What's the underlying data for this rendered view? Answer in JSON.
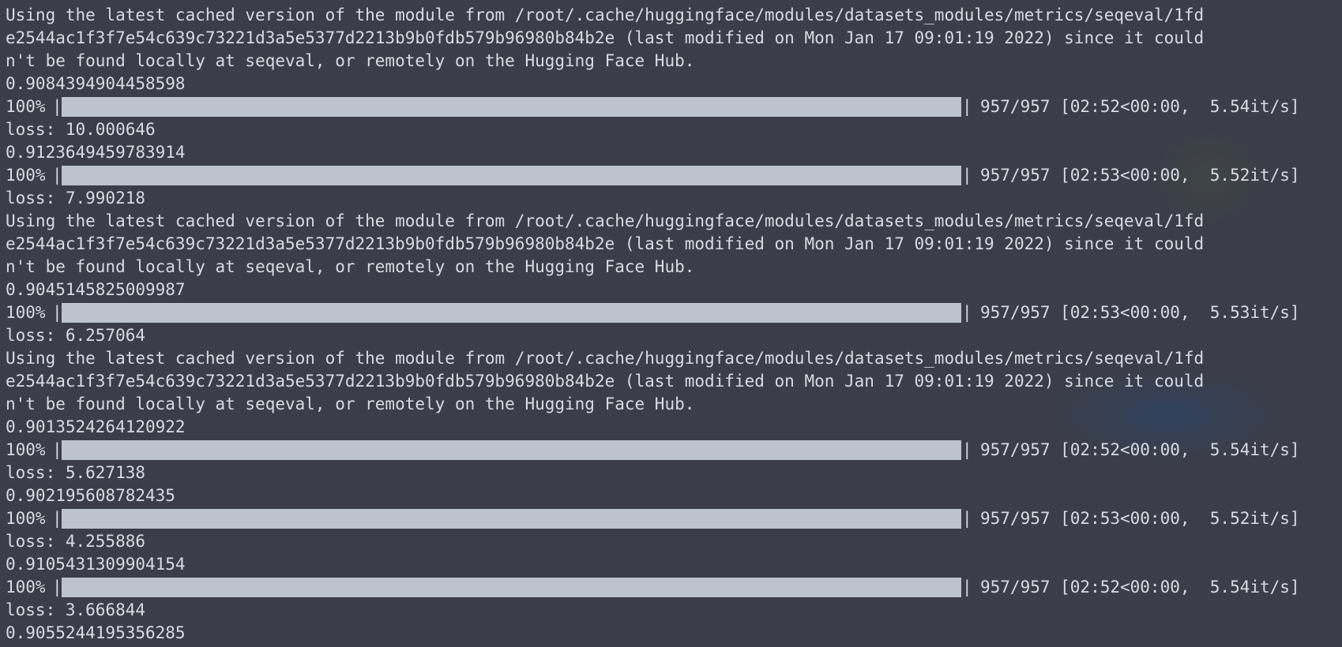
{
  "terminal": {
    "lines": [
      {
        "kind": "text",
        "text": "Using the latest cached version of the module from /root/.cache/huggingface/modules/datasets_modules/metrics/seqeval/1fd"
      },
      {
        "kind": "text",
        "text": "e2544ac1f3f7e54c639c73221d3a5e5377d2213b9b0fdb579b96980b84b2e (last modified on Mon Jan 17 09:01:19 2022) since it could"
      },
      {
        "kind": "text",
        "text": "n't be found locally at seqeval, or remotely on the Hugging Face Hub."
      },
      {
        "kind": "text",
        "text": "0.9084394904458598"
      },
      {
        "kind": "progress",
        "percent": "100%",
        "fraction": 1.0,
        "stats": "957/957 [02:52<00:00,  5.54it/s]"
      },
      {
        "kind": "text",
        "text": "loss: 10.000646"
      },
      {
        "kind": "text",
        "text": "0.9123649459783914"
      },
      {
        "kind": "progress",
        "percent": "100%",
        "fraction": 1.0,
        "stats": "957/957 [02:53<00:00,  5.52it/s]"
      },
      {
        "kind": "text",
        "text": "loss: 7.990218"
      },
      {
        "kind": "text",
        "text": "Using the latest cached version of the module from /root/.cache/huggingface/modules/datasets_modules/metrics/seqeval/1fd"
      },
      {
        "kind": "text",
        "text": "e2544ac1f3f7e54c639c73221d3a5e5377d2213b9b0fdb579b96980b84b2e (last modified on Mon Jan 17 09:01:19 2022) since it could"
      },
      {
        "kind": "text",
        "text": "n't be found locally at seqeval, or remotely on the Hugging Face Hub."
      },
      {
        "kind": "text",
        "text": "0.9045145825009987"
      },
      {
        "kind": "progress",
        "percent": "100%",
        "fraction": 1.0,
        "stats": "957/957 [02:53<00:00,  5.53it/s]"
      },
      {
        "kind": "text",
        "text": "loss: 6.257064"
      },
      {
        "kind": "text",
        "text": "Using the latest cached version of the module from /root/.cache/huggingface/modules/datasets_modules/metrics/seqeval/1fd"
      },
      {
        "kind": "text",
        "text": "e2544ac1f3f7e54c639c73221d3a5e5377d2213b9b0fdb579b96980b84b2e (last modified on Mon Jan 17 09:01:19 2022) since it could"
      },
      {
        "kind": "text",
        "text": "n't be found locally at seqeval, or remotely on the Hugging Face Hub."
      },
      {
        "kind": "text",
        "text": "0.9013524264120922"
      },
      {
        "kind": "progress",
        "percent": "100%",
        "fraction": 1.0,
        "stats": "957/957 [02:52<00:00,  5.54it/s]"
      },
      {
        "kind": "text",
        "text": "loss: 5.627138"
      },
      {
        "kind": "text",
        "text": "0.902195608782435"
      },
      {
        "kind": "progress",
        "percent": "100%",
        "fraction": 1.0,
        "stats": "957/957 [02:53<00:00,  5.52it/s]"
      },
      {
        "kind": "text",
        "text": "loss: 4.255886"
      },
      {
        "kind": "text",
        "text": "0.9105431309904154"
      },
      {
        "kind": "progress",
        "percent": "100%",
        "fraction": 1.0,
        "stats": "957/957 [02:52<00:00,  5.54it/s]"
      },
      {
        "kind": "text",
        "text": "loss: 3.666844"
      },
      {
        "kind": "text",
        "text": "0.9055244195356285"
      }
    ]
  },
  "colors": {
    "background": "#3b3e48",
    "text": "#d8dbe3",
    "progress_fill": "#bdc2cf"
  }
}
